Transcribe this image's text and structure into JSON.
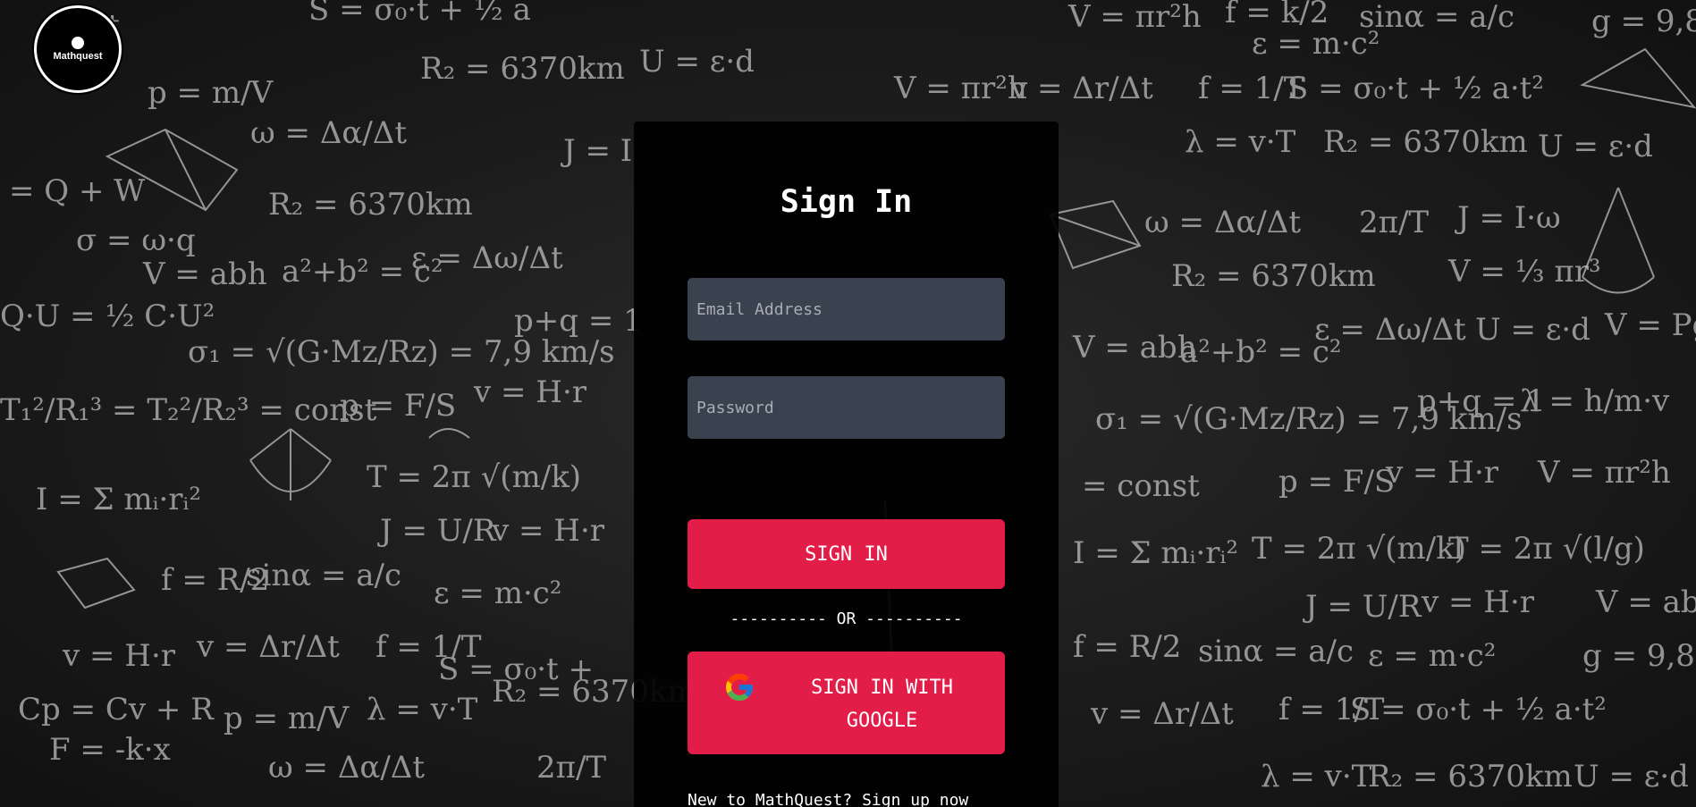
{
  "logo": {
    "text": "Mathquest"
  },
  "form": {
    "title": "Sign In",
    "email_placeholder": "Email Address",
    "password_placeholder": "Password",
    "signin_label": "SIGN IN",
    "divider": "---------- OR ----------",
    "google_label": "SIGN IN WITH GOOGLE",
    "signup_text": "New to MathQuest? Sign up now"
  },
  "colors": {
    "accent": "#e11d48",
    "input_bg": "#3a4250",
    "panel_bg": "#000000"
  },
  "icons": [
    "google-icon",
    "mathquest-logo"
  ]
}
